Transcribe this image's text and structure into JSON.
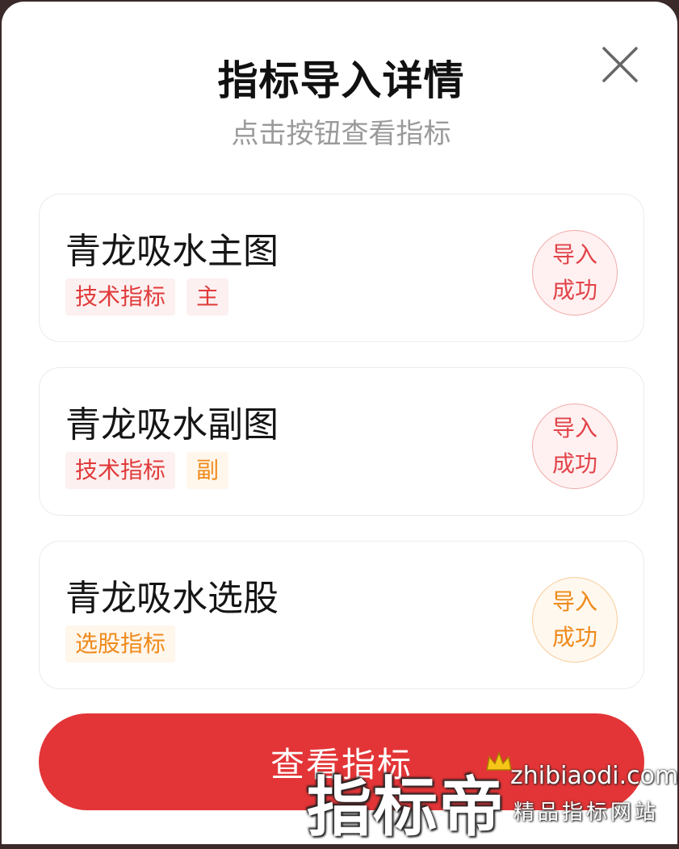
{
  "modal": {
    "title": "指标导入详情",
    "subtitle": "点击按钮查看指标"
  },
  "indicators": [
    {
      "name": "青龙吸水主图",
      "tags": [
        {
          "label": "技术指标",
          "color": "#e03a3a"
        },
        {
          "label": "主",
          "color": "#e03a3a"
        }
      ],
      "status_line1": "导入",
      "status_line2": "成功",
      "status_color": "#e2444a"
    },
    {
      "name": "青龙吸水副图",
      "tags": [
        {
          "label": "技术指标",
          "color": "#e03a3a"
        },
        {
          "label": "副",
          "color": "#ef8a1a"
        }
      ],
      "status_line1": "导入",
      "status_line2": "成功",
      "status_color": "#e2444a"
    },
    {
      "name": "青龙吸水选股",
      "tags": [
        {
          "label": "选股指标",
          "color": "#ef8a1a"
        }
      ],
      "status_line1": "导入",
      "status_line2": "成功",
      "status_color": "#ef8a1a"
    }
  ],
  "actions": {
    "view_label": "查看指标"
  },
  "watermark": {
    "brand": "指标帝",
    "url": "zhibiaodi.com",
    "slogan": "精品指标网站"
  },
  "colors": {
    "primary": "#e33537",
    "tag_red": "#e03a3a",
    "tag_orange": "#ef8a1a"
  },
  "icons": {
    "close": "close-icon",
    "crown": "crown-icon"
  }
}
